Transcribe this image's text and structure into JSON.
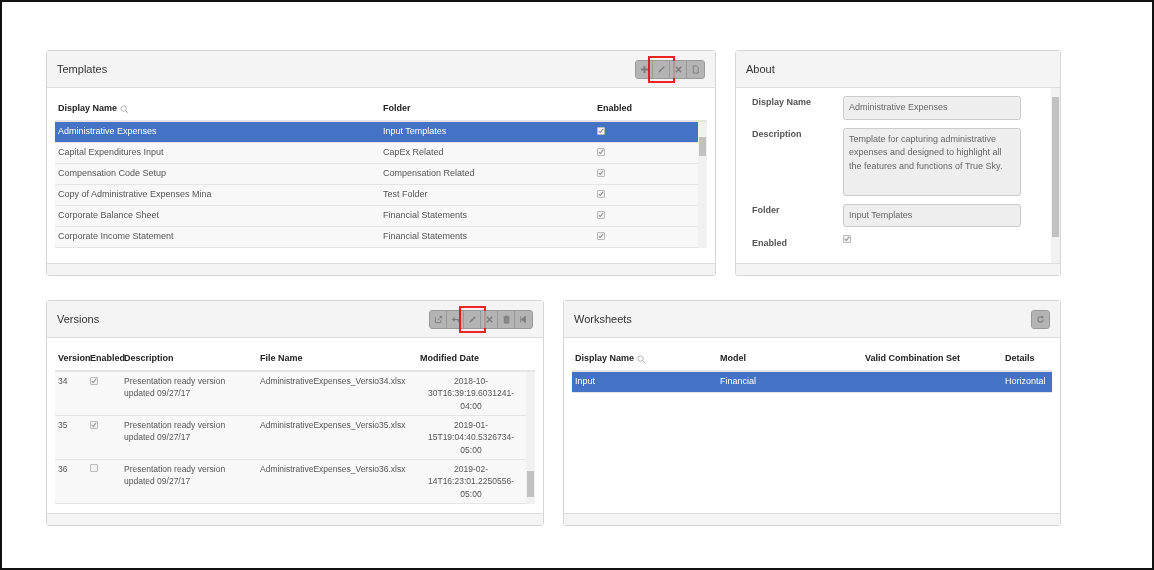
{
  "templates": {
    "title": "Templates",
    "toolbar": [
      {
        "disabled": true,
        "highlighted": false
      },
      {
        "disabled": true,
        "highlighted": true
      },
      {
        "disabled": true,
        "highlighted": false
      },
      {
        "disabled": true,
        "highlighted": false
      }
    ],
    "columns": [
      "Display Name",
      "Folder",
      "Enabled"
    ],
    "rows": [
      {
        "name": "Administrative Expenses",
        "folder": "Input Templates",
        "enabled": true,
        "selected": true
      },
      {
        "name": "Capital Expenditures Input",
        "folder": "CapEx Related",
        "enabled": true,
        "selected": false
      },
      {
        "name": "Compensation Code Setup",
        "folder": "Compensation Related",
        "enabled": true,
        "selected": false
      },
      {
        "name": "Copy of Administrative Expenses Mina",
        "folder": "Test Folder",
        "enabled": true,
        "selected": false
      },
      {
        "name": "Corporate Balance Sheet",
        "folder": "Financial Statements",
        "enabled": true,
        "selected": false
      },
      {
        "name": "Corporate Income Statement",
        "folder": "Financial Statements",
        "enabled": true,
        "selected": false
      }
    ]
  },
  "about": {
    "title": "About",
    "fields": [
      {
        "kind": "text",
        "label": "Display Name",
        "value": "Administrative Expenses"
      },
      {
        "kind": "textarea",
        "label": "Description",
        "value": "Template for capturing administrative expenses and designed to highlight all the features and functions of True Sky."
      },
      {
        "kind": "text",
        "label": "Folder",
        "value": "Input Templates"
      },
      {
        "kind": "checkbox",
        "label": "Enabled",
        "checked": true
      }
    ]
  },
  "versions": {
    "title": "Versions",
    "toolbar": [
      {
        "disabled": true,
        "highlighted": false
      },
      {
        "disabled": true,
        "highlighted": false
      },
      {
        "disabled": true,
        "highlighted": true
      },
      {
        "disabled": true,
        "highlighted": false
      },
      {
        "disabled": true,
        "highlighted": false
      },
      {
        "disabled": true,
        "highlighted": false
      }
    ],
    "columns": [
      "Version",
      "Enabled",
      "Description",
      "File Name",
      "Modified Date"
    ],
    "rows": [
      {
        "version": "34",
        "enabled": true,
        "description": "Presentation ready version updated 09/27/17",
        "file": "AdministrativeExpenses_Versio34.xlsx",
        "modified": "2018-10-30T16:39:19.6031241-04:00"
      },
      {
        "version": "35",
        "enabled": true,
        "description": "Presentation ready version updated 09/27/17",
        "file": "AdministrativeExpenses_Versio35.xlsx",
        "modified": "2019-01-15T19:04:40.5326734-05:00"
      },
      {
        "version": "36",
        "enabled": false,
        "description": "Presentation ready version updated 09/27/17",
        "file": "AdministrativeExpenses_Versio36.xlsx",
        "modified": "2019-02-14T16:23:01.2250556-05:00"
      }
    ]
  },
  "worksheets": {
    "title": "Worksheets",
    "toolbar": [
      {
        "disabled": true
      }
    ],
    "columns": [
      "Display Name",
      "Model",
      "Valid Combination Set",
      "Details"
    ],
    "rows": [
      {
        "name": "Input",
        "model": "Financial",
        "details": "Horizontal",
        "selected": true
      }
    ]
  }
}
